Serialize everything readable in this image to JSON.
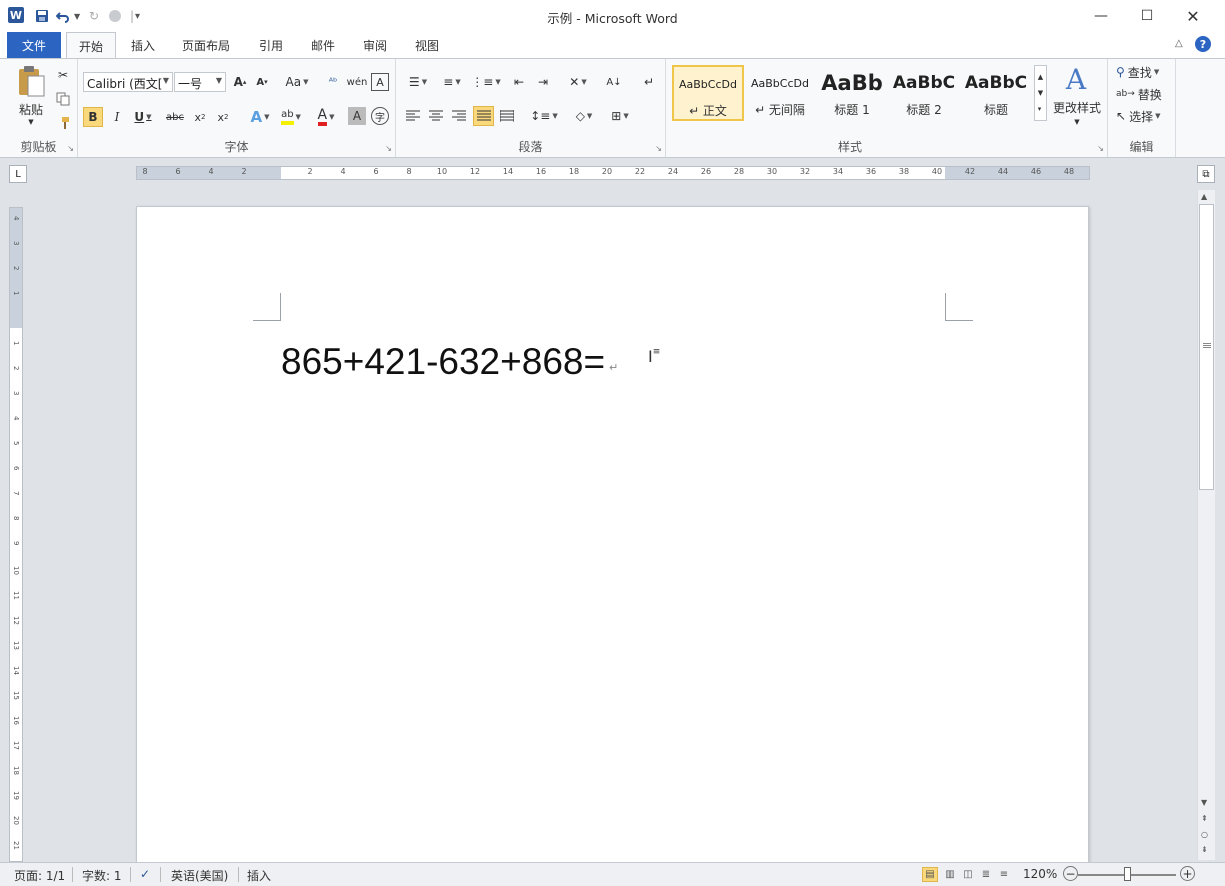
{
  "titlebar": {
    "title": "示例 - Microsoft Word",
    "app_icon": "W",
    "icons": {
      "save": "save-icon",
      "undo": "undo-icon",
      "redo": "redo-icon",
      "repeat": "repeat-icon",
      "customize": "customize-qat-icon"
    },
    "window_buttons": {
      "minimize": "—",
      "maximize": "☐",
      "close": "✕"
    }
  },
  "tabs": {
    "file": "文件",
    "items": [
      "开始",
      "插入",
      "页面布局",
      "引用",
      "邮件",
      "审阅",
      "视图"
    ],
    "active": "开始"
  },
  "ribbon": {
    "clipboard": {
      "label": "剪贴板",
      "paste": "粘贴"
    },
    "font": {
      "label": "字体",
      "font_name": "Calibri (西文[",
      "font_size": "一号"
    },
    "paragraph": {
      "label": "段落"
    },
    "styles": {
      "label": "样式",
      "items": [
        {
          "preview": "AaBbCcDd",
          "name": "↵ 正文"
        },
        {
          "preview": "AaBbCcDd",
          "name": "↵ 无间隔"
        },
        {
          "preview": "AaBb",
          "name": "标题 1"
        },
        {
          "preview": "AaBbC",
          "name": "标题 2"
        },
        {
          "preview": "AaBbC",
          "name": "标题"
        }
      ],
      "change_styles": "更改样式"
    },
    "editing": {
      "label": "编辑",
      "find": "查找",
      "replace": "替换",
      "select": "选择"
    }
  },
  "ruler": {
    "h_ticks": [
      "8",
      "6",
      "4",
      "2",
      "",
      "2",
      "4",
      "6",
      "8",
      "10",
      "12",
      "14",
      "16",
      "18",
      "20",
      "22",
      "24",
      "26",
      "28",
      "30",
      "32",
      "34",
      "36",
      "38",
      "40",
      "42",
      "44",
      "46",
      "48"
    ],
    "v_ticks": [
      "4",
      "3",
      "2",
      "1",
      "",
      "1",
      "2",
      "3",
      "4",
      "5",
      "6",
      "7",
      "8",
      "9",
      "10",
      "11",
      "12",
      "13",
      "14",
      "15",
      "16",
      "17",
      "18",
      "19",
      "20",
      "21"
    ]
  },
  "document": {
    "text": "865+421-632+868=",
    "paragraph_mark": "↵"
  },
  "statusbar": {
    "page": "页面: 1/1",
    "words": "字数: 1",
    "language": "英语(美国)",
    "mode": "插入",
    "zoom": "120%",
    "zoom_level": 0.5
  }
}
